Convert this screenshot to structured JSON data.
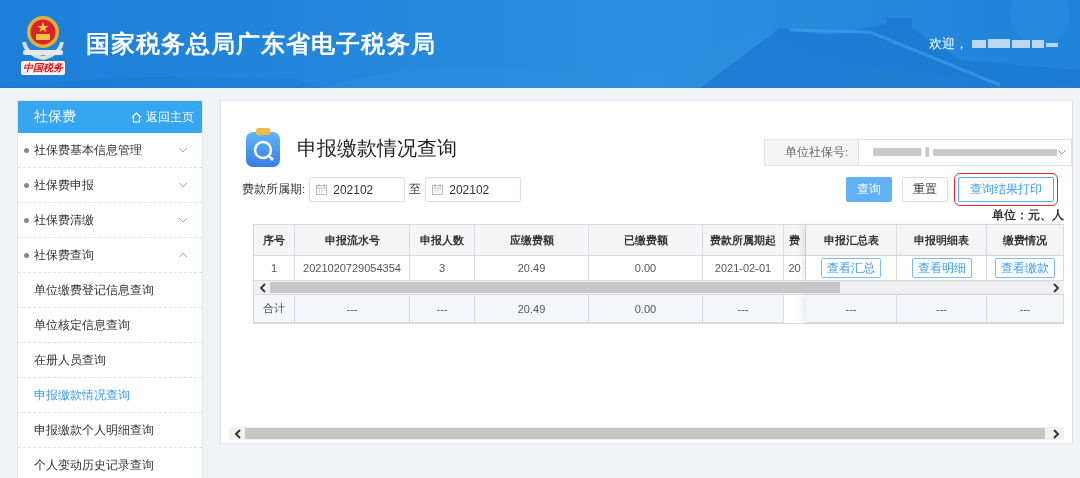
{
  "header": {
    "logo_caption": "中国税务",
    "title": "国家税务总局广东省电子税务局",
    "welcome": "欢迎，"
  },
  "sidebar": {
    "title": "社保费",
    "home_link": "返回主页",
    "items": [
      {
        "label": "社保费基本信息管理",
        "expanded": false
      },
      {
        "label": "社保费申报",
        "expanded": false
      },
      {
        "label": "社保费清缴",
        "expanded": false
      },
      {
        "label": "社保费查询",
        "expanded": true,
        "children": [
          {
            "label": "单位缴费登记信息查询",
            "selected": false
          },
          {
            "label": "单位核定信息查询",
            "selected": false
          },
          {
            "label": "在册人员查询",
            "selected": false
          },
          {
            "label": "申报缴款情况查询",
            "selected": true
          },
          {
            "label": "申报缴款个人明细查询",
            "selected": false
          },
          {
            "label": "个人变动历史记录查询",
            "selected": false
          }
        ]
      }
    ]
  },
  "page": {
    "title": "申报缴款情况查询",
    "unit_label": "单位社保号:",
    "period_label": "费款所属期:",
    "period_from": "202102",
    "period_sep": "至",
    "period_to": "202102",
    "buttons": [
      {
        "label": "查询",
        "kind": "primary"
      },
      {
        "label": "重置",
        "kind": "plain"
      },
      {
        "label": "查询结果打印",
        "kind": "outline"
      }
    ],
    "unit_note": "单位：元、人"
  },
  "table": {
    "columns": [
      "序号",
      "申报流水号",
      "申报人数",
      "应缴费额",
      "已缴费额",
      "费款所属期起",
      "费"
    ],
    "fixed_columns": [
      "申报汇总表",
      "申报明细表",
      "缴费情况"
    ],
    "rows": [
      {
        "cells": [
          "1",
          "2021020729054354",
          "3",
          "20.49",
          "0.00",
          "2021-02-01",
          "20"
        ],
        "actions": [
          "查看汇总",
          "查看明细",
          "查看缴款"
        ]
      }
    ],
    "footer": {
      "cells": [
        "合计",
        "---",
        "---",
        "20.49",
        "0.00",
        "---"
      ],
      "fixed_cells": [
        "---",
        "---",
        "---"
      ]
    }
  }
}
